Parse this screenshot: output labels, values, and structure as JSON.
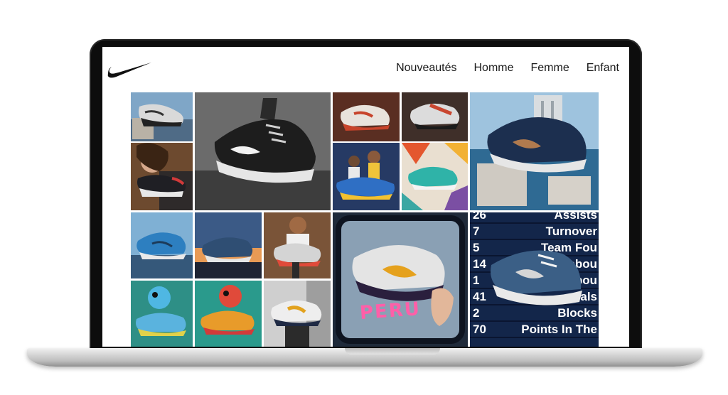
{
  "nav": {
    "items": [
      {
        "label": "Nouveautés"
      },
      {
        "label": "Homme"
      },
      {
        "label": "Femme"
      },
      {
        "label": "Enfant"
      }
    ]
  },
  "scoreboard": {
    "rows": [
      {
        "num": "26",
        "label": "Assists"
      },
      {
        "num": "7",
        "label": "Turnover"
      },
      {
        "num": "5",
        "label": "Team Fou"
      },
      {
        "num": "14",
        "label": "tal Rebou"
      },
      {
        "num": "1",
        "label": "Rebou"
      },
      {
        "num": "41",
        "label": "eals"
      },
      {
        "num": "2",
        "label": "Blocks"
      },
      {
        "num": "70",
        "label": "Points In The"
      },
      {
        "num": "",
        "label": ""
      }
    ]
  },
  "photo_text": {
    "handwriting": "PERU"
  },
  "colors": {
    "brand": "#111111",
    "accent": "#e4572e"
  }
}
